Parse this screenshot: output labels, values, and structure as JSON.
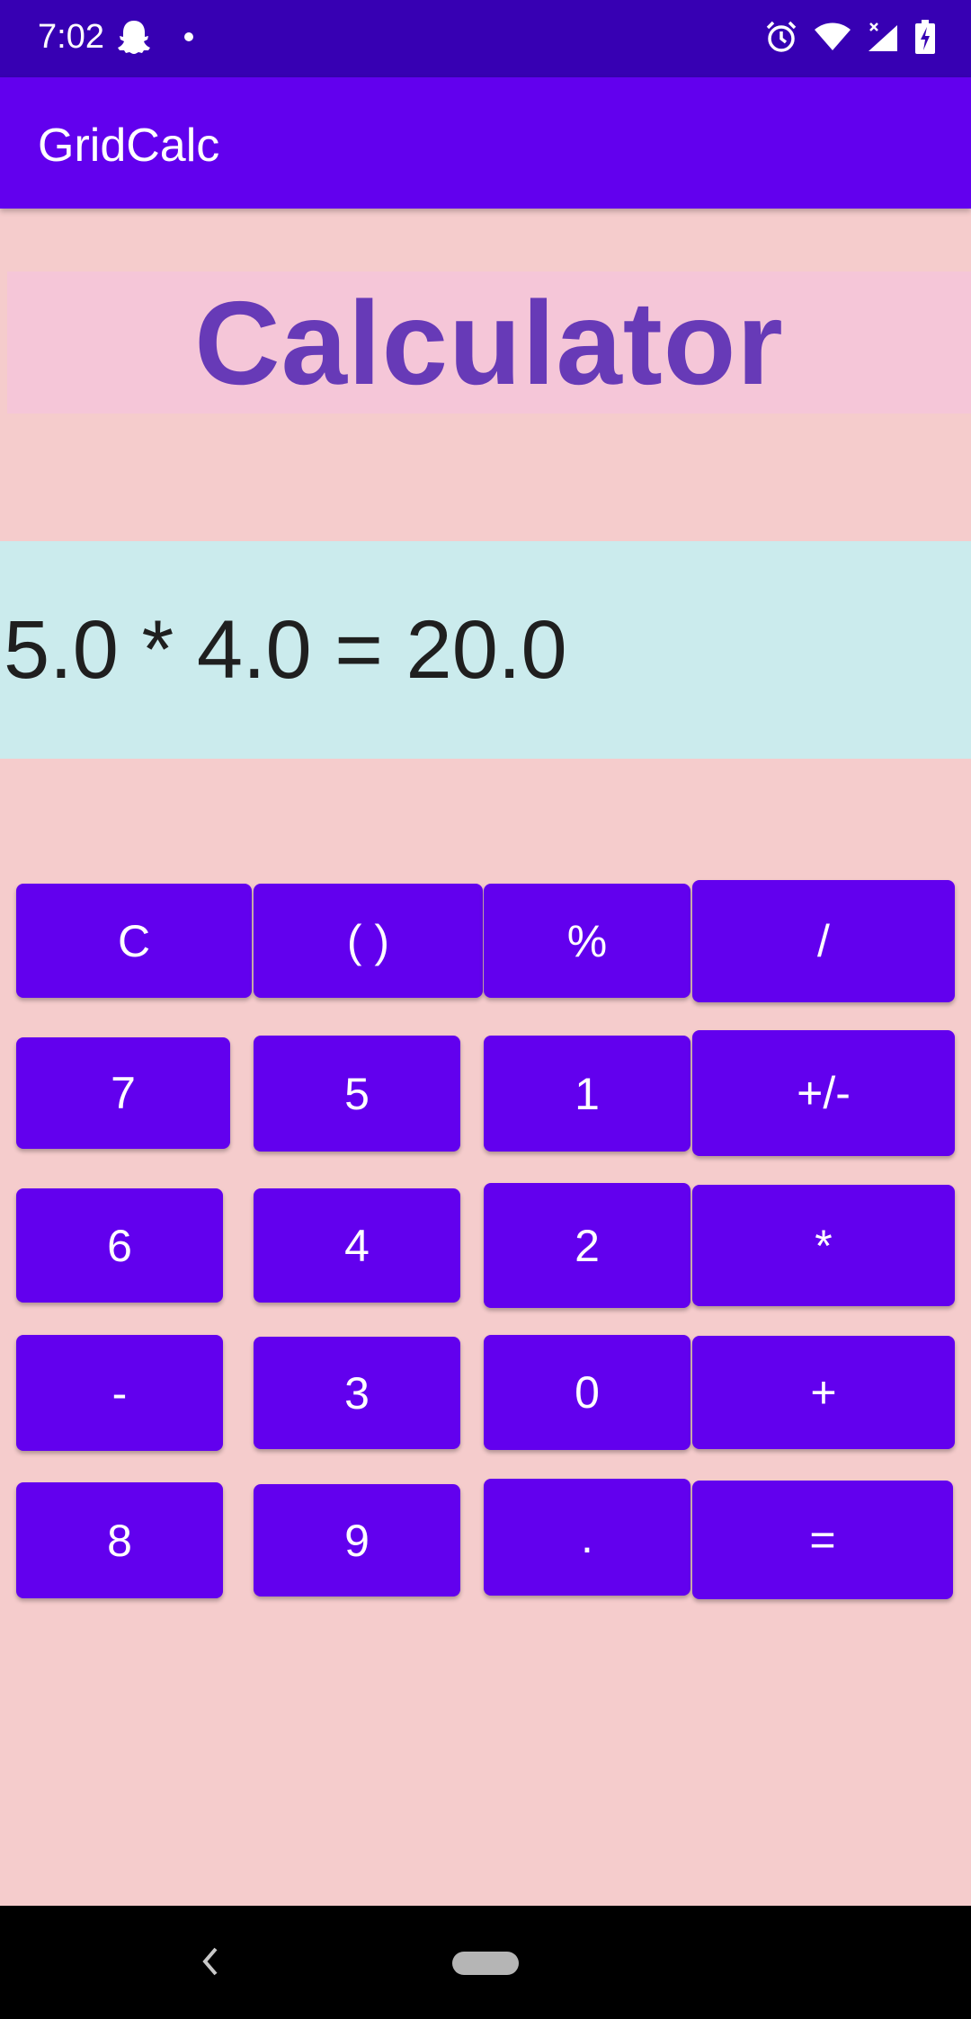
{
  "status_bar": {
    "time": "7:02",
    "icons": [
      "snapchat-ghost-icon",
      "notification-dot-icon",
      "alarm-icon",
      "wifi-icon",
      "cell-signal-icon",
      "battery-charging-icon"
    ]
  },
  "app_bar": {
    "title": "GridCalc"
  },
  "heading": {
    "text": "Calculator"
  },
  "display": {
    "expression": "5.0 * 4.0 = 20.0"
  },
  "keypad": {
    "btn_c": "C",
    "btn_parens": "( )",
    "btn_percent": "%",
    "btn_divide": "/",
    "btn_7": "7",
    "btn_5": "5",
    "btn_1": "1",
    "btn_plus_minus": "+/-",
    "btn_6": "6",
    "btn_4": "4",
    "btn_2": "2",
    "btn_multiply": "*",
    "btn_minus": "-",
    "btn_3": "3",
    "btn_0": "0",
    "btn_plus": "+",
    "btn_8": "8",
    "btn_9": "9",
    "btn_dot": ".",
    "btn_equals": "="
  },
  "colors": {
    "status_bar": "#3700b3",
    "app_bar": "#6200ee",
    "background": "#f5cccc",
    "heading_bg": "#f5c6d8",
    "heading_text": "#673ab7",
    "display_bg": "#cbebed",
    "button": "#6200ee"
  }
}
